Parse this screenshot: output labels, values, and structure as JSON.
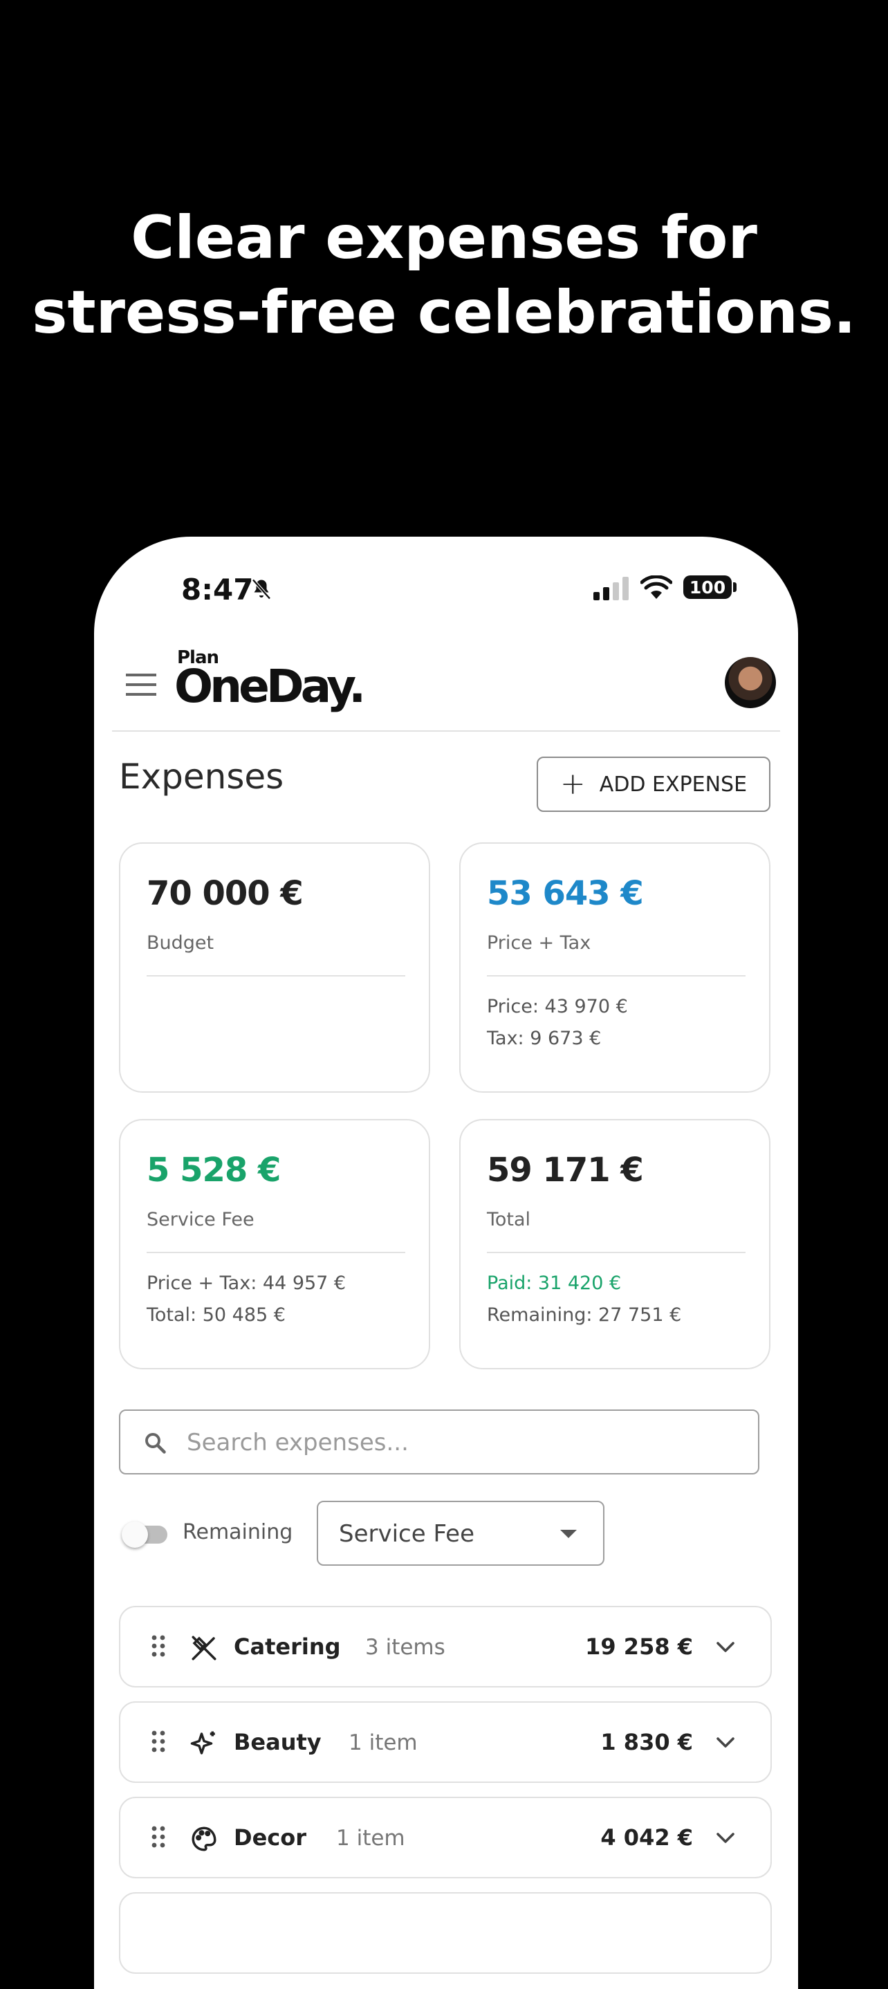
{
  "headline": [
    "Clear expenses for",
    "stress-free celebrations."
  ],
  "status_bar": {
    "time": "8:47",
    "battery": "100"
  },
  "header": {
    "logo_small": "Plan",
    "logo_main": "OneDay."
  },
  "page": {
    "title": "Expenses",
    "add_button": "ADD EXPENSE"
  },
  "cards": {
    "budget": {
      "amount": "70 000 €",
      "label": "Budget"
    },
    "price_tax": {
      "amount": "53 643 €",
      "label": "Price + Tax",
      "line1": "Price: 43 970 €",
      "line2": "Tax: 9 673 €"
    },
    "service_fee": {
      "amount": "5 528 €",
      "label": "Service Fee",
      "line1": "Price + Tax: 44 957 €",
      "line2": "Total: 50 485 €"
    },
    "total": {
      "amount": "59 171 €",
      "label": "Total",
      "line1": "Paid: 31 420 €",
      "line2": "Remaining: 27 751 €"
    }
  },
  "search": {
    "placeholder": "Search expenses..."
  },
  "filters": {
    "toggle_label": "Remaining",
    "select_value": "Service Fee"
  },
  "categories": [
    {
      "name": "Catering",
      "count": "3 items",
      "amount": "19 258 €",
      "icon": "utensils-crossed-icon"
    },
    {
      "name": "Beauty",
      "count": "1 item",
      "amount": "1 830 €",
      "icon": "sparkles-icon"
    },
    {
      "name": "Decor",
      "count": "1 item",
      "amount": "4 042 €",
      "icon": "palette-icon"
    }
  ],
  "colors": {
    "blue": "#1e88c9",
    "green": "#19a36a",
    "background": "#000000"
  }
}
